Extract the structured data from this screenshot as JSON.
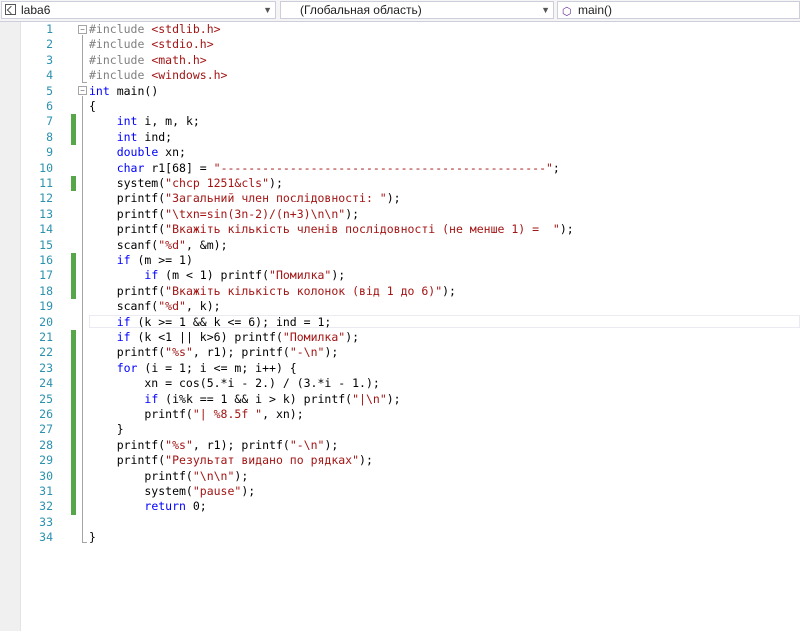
{
  "navbar": {
    "project": "laba6",
    "scope": "(Глобальная область)",
    "member": "main()"
  },
  "editor": {
    "current_line": 20,
    "lines": [
      {
        "n": "1",
        "changed": false,
        "tokens": [
          {
            "t": "#include ",
            "c": "pp"
          },
          {
            "t": "<stdlib.h>",
            "c": "str"
          }
        ]
      },
      {
        "n": "2",
        "changed": false,
        "tokens": [
          {
            "t": "#include ",
            "c": "pp"
          },
          {
            "t": "<stdio.h>",
            "c": "str"
          }
        ]
      },
      {
        "n": "3",
        "changed": false,
        "tokens": [
          {
            "t": "#include ",
            "c": "pp"
          },
          {
            "t": "<math.h>",
            "c": "str"
          }
        ]
      },
      {
        "n": "4",
        "changed": false,
        "tokens": [
          {
            "t": "#include ",
            "c": "pp"
          },
          {
            "t": "<windows.h>",
            "c": "str"
          }
        ]
      },
      {
        "n": "5",
        "changed": false,
        "tokens": [
          {
            "t": "int",
            "c": "kw"
          },
          {
            "t": " main()",
            "c": ""
          }
        ]
      },
      {
        "n": "6",
        "changed": false,
        "tokens": [
          {
            "t": "{",
            "c": ""
          }
        ]
      },
      {
        "n": "7",
        "changed": true,
        "tokens": [
          {
            "t": "    ",
            "c": ""
          },
          {
            "t": "int",
            "c": "kw"
          },
          {
            "t": " i, m, k;",
            "c": ""
          }
        ]
      },
      {
        "n": "8",
        "changed": true,
        "tokens": [
          {
            "t": "    ",
            "c": ""
          },
          {
            "t": "int",
            "c": "kw"
          },
          {
            "t": " ind;",
            "c": ""
          }
        ]
      },
      {
        "n": "9",
        "changed": false,
        "tokens": [
          {
            "t": "    ",
            "c": ""
          },
          {
            "t": "double",
            "c": "kw"
          },
          {
            "t": " xn;",
            "c": ""
          }
        ]
      },
      {
        "n": "10",
        "changed": false,
        "tokens": [
          {
            "t": "    ",
            "c": ""
          },
          {
            "t": "char",
            "c": "kw"
          },
          {
            "t": " r1[68] = ",
            "c": ""
          },
          {
            "t": "\"-----------------------------------------------\"",
            "c": "str"
          },
          {
            "t": ";",
            "c": ""
          }
        ]
      },
      {
        "n": "11",
        "changed": true,
        "tokens": [
          {
            "t": "    system(",
            "c": ""
          },
          {
            "t": "\"chcp 1251&cls\"",
            "c": "str"
          },
          {
            "t": ");",
            "c": ""
          }
        ]
      },
      {
        "n": "12",
        "changed": false,
        "tokens": [
          {
            "t": "    printf(",
            "c": ""
          },
          {
            "t": "\"Загальний член послідовності: \"",
            "c": "str"
          },
          {
            "t": ");",
            "c": ""
          }
        ]
      },
      {
        "n": "13",
        "changed": false,
        "tokens": [
          {
            "t": "    printf(",
            "c": ""
          },
          {
            "t": "\"\\txn=sin(3n-2)/(n+3)\\n\\n\"",
            "c": "str"
          },
          {
            "t": ");",
            "c": ""
          }
        ]
      },
      {
        "n": "14",
        "changed": false,
        "tokens": [
          {
            "t": "    printf(",
            "c": ""
          },
          {
            "t": "\"Вкажіть кількість членів послідовності (не менше 1) =  \"",
            "c": "str"
          },
          {
            "t": ");",
            "c": ""
          }
        ]
      },
      {
        "n": "15",
        "changed": false,
        "tokens": [
          {
            "t": "    scanf(",
            "c": ""
          },
          {
            "t": "\"%d\"",
            "c": "str"
          },
          {
            "t": ", &m);",
            "c": ""
          }
        ]
      },
      {
        "n": "16",
        "changed": true,
        "tokens": [
          {
            "t": "    ",
            "c": ""
          },
          {
            "t": "if",
            "c": "kw"
          },
          {
            "t": " (m >= 1)",
            "c": ""
          }
        ]
      },
      {
        "n": "17",
        "changed": true,
        "tokens": [
          {
            "t": "        ",
            "c": ""
          },
          {
            "t": "if",
            "c": "kw"
          },
          {
            "t": " (m < 1) printf(",
            "c": ""
          },
          {
            "t": "\"Помилка\"",
            "c": "str"
          },
          {
            "t": ");",
            "c": ""
          }
        ]
      },
      {
        "n": "18",
        "changed": true,
        "tokens": [
          {
            "t": "    printf(",
            "c": ""
          },
          {
            "t": "\"Вкажіть кількість колонок (від 1 до 6)\"",
            "c": "str"
          },
          {
            "t": ");",
            "c": ""
          }
        ]
      },
      {
        "n": "19",
        "changed": false,
        "tokens": [
          {
            "t": "    scanf(",
            "c": ""
          },
          {
            "t": "\"%d\"",
            "c": "str"
          },
          {
            "t": ", k);",
            "c": ""
          }
        ]
      },
      {
        "n": "20",
        "changed": false,
        "tokens": [
          {
            "t": "    ",
            "c": ""
          },
          {
            "t": "if",
            "c": "kw"
          },
          {
            "t": " (k >= 1 && k <= 6); ind = 1;",
            "c": ""
          }
        ]
      },
      {
        "n": "21",
        "changed": true,
        "tokens": [
          {
            "t": "    ",
            "c": ""
          },
          {
            "t": "if",
            "c": "kw"
          },
          {
            "t": " (k <1 || k>6) printf(",
            "c": ""
          },
          {
            "t": "\"Помилка\"",
            "c": "str"
          },
          {
            "t": ");",
            "c": ""
          }
        ]
      },
      {
        "n": "22",
        "changed": true,
        "tokens": [
          {
            "t": "    printf(",
            "c": ""
          },
          {
            "t": "\"%s\"",
            "c": "str"
          },
          {
            "t": ", r1); printf(",
            "c": ""
          },
          {
            "t": "\"-\\n\"",
            "c": "str"
          },
          {
            "t": ");",
            "c": ""
          }
        ]
      },
      {
        "n": "23",
        "changed": true,
        "tokens": [
          {
            "t": "    ",
            "c": ""
          },
          {
            "t": "for",
            "c": "kw"
          },
          {
            "t": " (i = 1; i <= m; i++) {",
            "c": ""
          }
        ]
      },
      {
        "n": "24",
        "changed": true,
        "tokens": [
          {
            "t": "        xn = cos(5.*i - 2.) / (3.*i - 1.);",
            "c": ""
          }
        ]
      },
      {
        "n": "25",
        "changed": true,
        "tokens": [
          {
            "t": "        ",
            "c": ""
          },
          {
            "t": "if",
            "c": "kw"
          },
          {
            "t": " (i%k == 1 && i > k) printf(",
            "c": ""
          },
          {
            "t": "\"|\\n\"",
            "c": "str"
          },
          {
            "t": ");",
            "c": ""
          }
        ]
      },
      {
        "n": "26",
        "changed": true,
        "tokens": [
          {
            "t": "        printf(",
            "c": ""
          },
          {
            "t": "\"| %8.5f \"",
            "c": "str"
          },
          {
            "t": ", xn);",
            "c": ""
          }
        ]
      },
      {
        "n": "27",
        "changed": true,
        "tokens": [
          {
            "t": "    }",
            "c": ""
          }
        ]
      },
      {
        "n": "28",
        "changed": true,
        "tokens": [
          {
            "t": "    printf(",
            "c": ""
          },
          {
            "t": "\"%s\"",
            "c": "str"
          },
          {
            "t": ", r1); printf(",
            "c": ""
          },
          {
            "t": "\"-\\n\"",
            "c": "str"
          },
          {
            "t": ");",
            "c": ""
          }
        ]
      },
      {
        "n": "29",
        "changed": true,
        "tokens": [
          {
            "t": "    printf(",
            "c": ""
          },
          {
            "t": "\"Результат видано по рядках\"",
            "c": "str"
          },
          {
            "t": ");",
            "c": ""
          }
        ]
      },
      {
        "n": "30",
        "changed": true,
        "tokens": [
          {
            "t": "        printf(",
            "c": ""
          },
          {
            "t": "\"\\n\\n\"",
            "c": "str"
          },
          {
            "t": ");",
            "c": ""
          }
        ]
      },
      {
        "n": "31",
        "changed": true,
        "tokens": [
          {
            "t": "        system(",
            "c": ""
          },
          {
            "t": "\"pause\"",
            "c": "str"
          },
          {
            "t": ");",
            "c": ""
          }
        ]
      },
      {
        "n": "32",
        "changed": true,
        "tokens": [
          {
            "t": "        ",
            "c": ""
          },
          {
            "t": "return",
            "c": "kw"
          },
          {
            "t": " 0;",
            "c": ""
          }
        ]
      },
      {
        "n": "33",
        "changed": false,
        "tokens": []
      },
      {
        "n": "34",
        "changed": false,
        "tokens": [
          {
            "t": "}",
            "c": ""
          }
        ]
      }
    ]
  }
}
